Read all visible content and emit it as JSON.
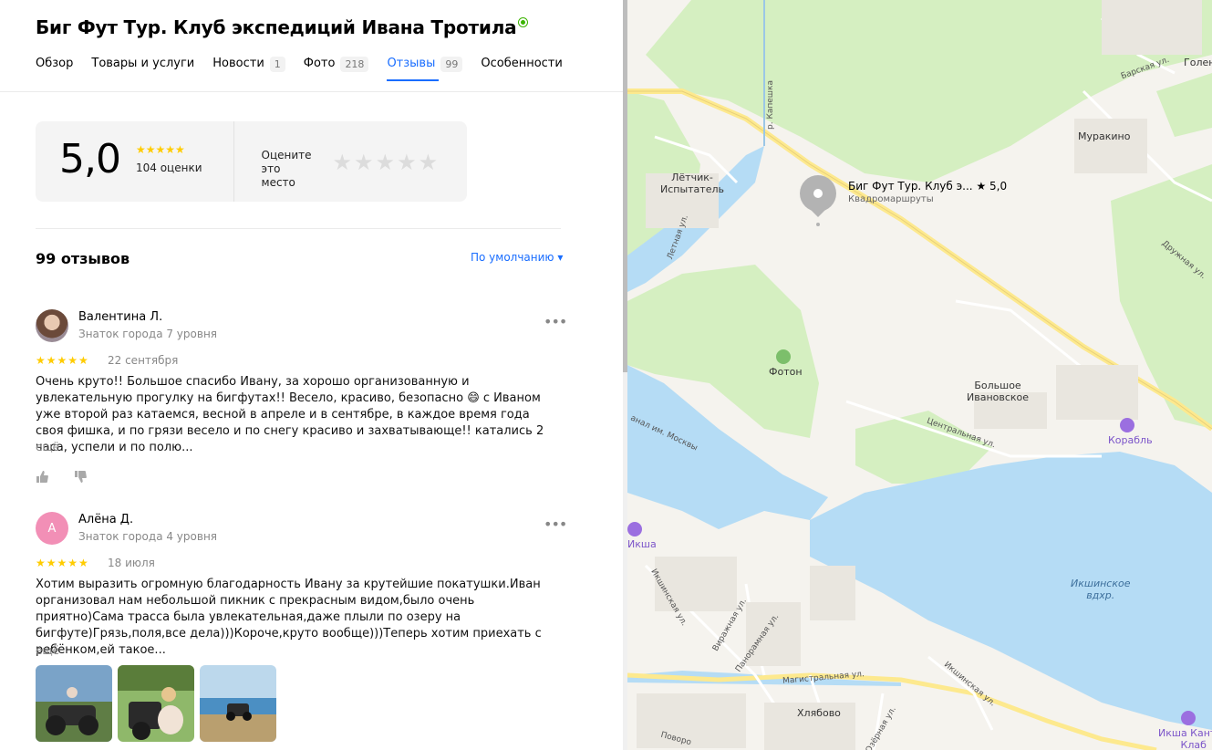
{
  "org": {
    "title": "Биг Фут Тур. Клуб экспедиций Ивана Тротила",
    "verified": true
  },
  "tabs": [
    {
      "label": "Обзор",
      "count": ""
    },
    {
      "label": "Товары и услуги",
      "count": ""
    },
    {
      "label": "Новости",
      "count": "1"
    },
    {
      "label": "Фото",
      "count": "218"
    },
    {
      "label": "Отзывы",
      "count": "99",
      "active": true
    },
    {
      "label": "Особенности",
      "count": ""
    }
  ],
  "rating": {
    "value": "5,0",
    "stars": "★★★★★",
    "count_label": "104 оценки",
    "rate_prompt": "Оцените это место",
    "rate_stars": "★★★★★"
  },
  "reviews_header": {
    "count_label": "99 отзывов",
    "sort_label": "По умолчанию ▾"
  },
  "reviews": [
    {
      "author": "Валентина Л.",
      "level": "Знаток города 7 уровня",
      "stars": "★★★★★",
      "date": "22 сентября",
      "text": "Очень круто!! Большое спасибо Ивану, за хорошо организованную и увлекательную прогулку на бигфутах!! Весело, красиво, безопасно 😄 с Иваном уже второй раз катаемся, весной в апреле и в сентябре, в каждое время года своя фишка, и по грязи весело и по снегу красиво и захватывающе!! катались 2 часа, успели и по полю...",
      "more": "ещё",
      "avatar_letter": ""
    },
    {
      "author": "Алёна Д.",
      "level": "Знаток города 4 уровня",
      "stars": "★★★★★",
      "date": "18 июля",
      "text": "Хотим выразить огромную благодарность Ивану за крутейшие покатушки.Иван организовал нам небольшой пикник с прекрасным видом,было очень приятно)Сама трасса была увлекательная,даже плыли по озеру на бигфуте)Грязь,поля,все дела)))Короче,круто вообще)))Теперь хотим приехать с ребёнком,ей такое...",
      "more": "ещё",
      "avatar_letter": "А"
    }
  ],
  "map": {
    "pin_title": "Биг Фут Тур. Клуб э...",
    "pin_rating": "★ 5,0",
    "pin_category": "Квадромаршруты",
    "labels": {
      "muraki": "Муракино",
      "letchik": "Лётчик-\nИспытатель",
      "bolshoe": "Большое\nИвановское",
      "foton": "Фотон",
      "korabl": "Корабль",
      "iksha_res": "Икшинское\nвдхр.",
      "iksha": "Икша",
      "hlyabovo": "Хлябово",
      "iksha_country": "Икша Кантри\nКлаб",
      "golen": "Голен"
    },
    "streets": {
      "barskaya": "Барская ул.",
      "druzhnaya": "Дружная ул.",
      "letnyaya": "Летная ул.",
      "kapeshka": "р. Капешка",
      "central": "Центральная ул.",
      "canal": "анал им. Москвы",
      "iksh_street": "Икшинская ул.",
      "virazhnaya": "Виражная ул.",
      "panoramnaya": "Панорамная ул.",
      "magistral": "Магистральная ул.",
      "iksh2": "Икшинская ул.",
      "povorot": "Поворо",
      "ozern": "Озёрная ул."
    }
  },
  "colors": {
    "accent": "#196dff",
    "star": "#ffcc00",
    "water": "#b5dcf5",
    "forest": "#d5efc1",
    "ground": "#f5f3ee"
  }
}
